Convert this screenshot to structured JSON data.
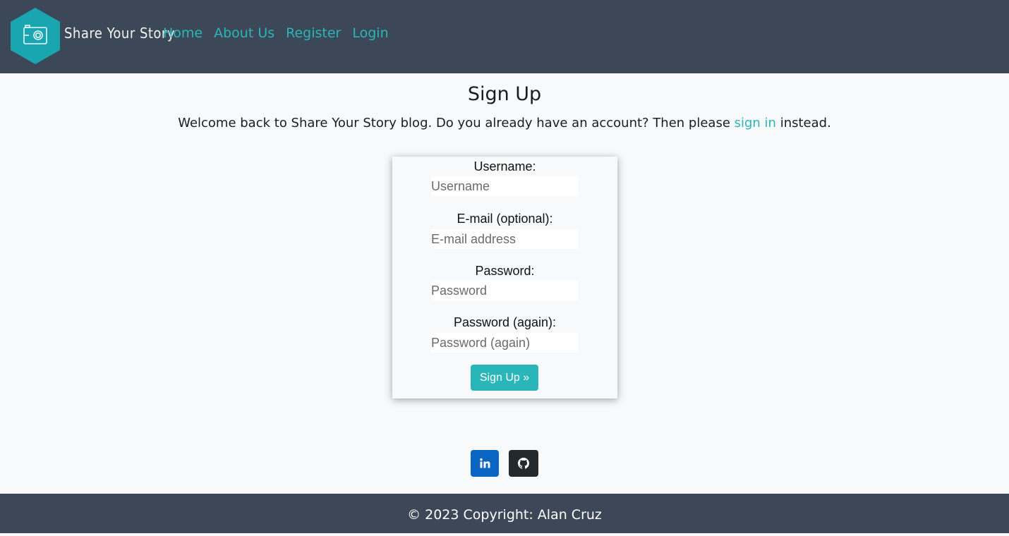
{
  "brand": {
    "name": "Share Your Story"
  },
  "nav": {
    "links": [
      "Home",
      "About Us",
      "Register",
      "Login"
    ]
  },
  "page": {
    "title": "Sign Up",
    "intro_prefix": "Welcome back to Share Your Story blog. Do you already have an account? Then please ",
    "intro_link": "sign in",
    "intro_suffix": " instead."
  },
  "form": {
    "username": {
      "label": "Username:",
      "placeholder": "Username"
    },
    "email": {
      "label": "E-mail (optional):",
      "placeholder": "E-mail address"
    },
    "password": {
      "label": "Password:",
      "placeholder": "Password"
    },
    "password2": {
      "label": "Password (again):",
      "placeholder": "Password (again)"
    },
    "submit": "Sign Up »"
  },
  "footer": {
    "copyright": "© 2023 Copyright: Alan Cruz"
  },
  "colors": {
    "navbar": "#3c4858",
    "accent": "#2ab6b8",
    "linkedin": "#0a66c2",
    "github": "#24292e"
  },
  "icons": [
    "camera-icon",
    "linkedin-icon",
    "github-icon"
  ]
}
